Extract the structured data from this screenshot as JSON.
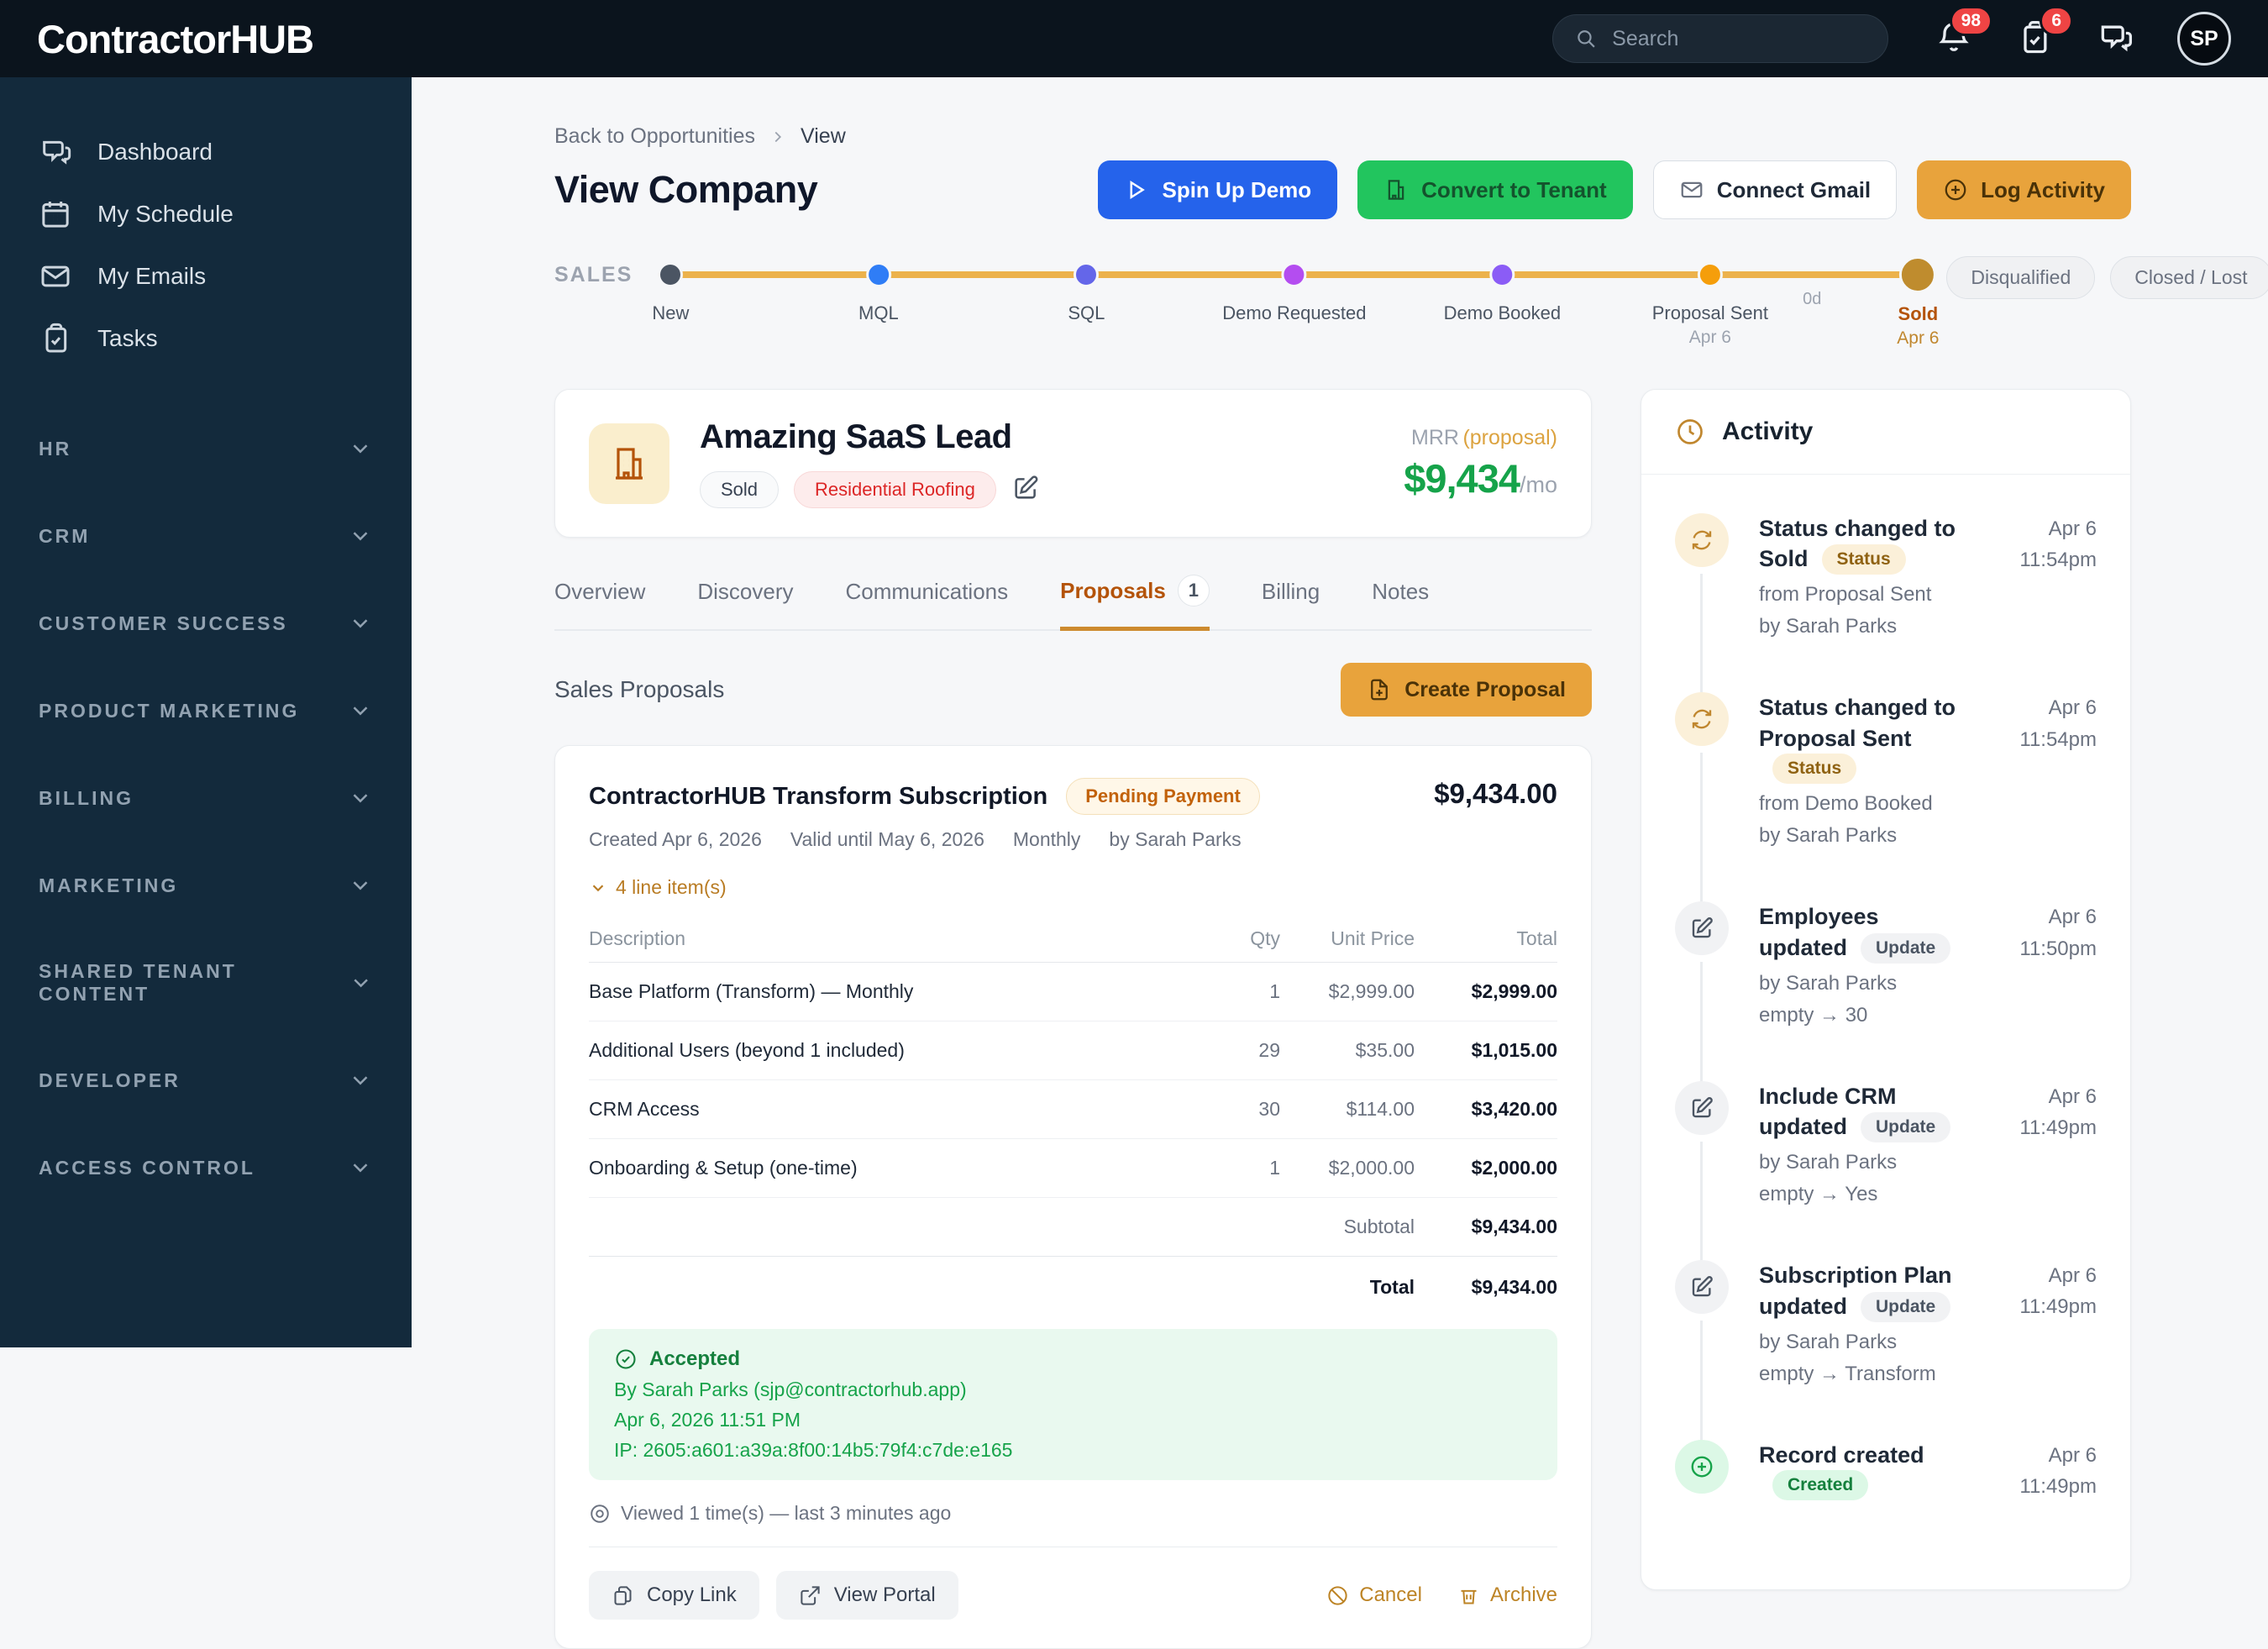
{
  "navbar": {
    "logo_part1": "Contractor",
    "logo_part2": "HUB",
    "search_placeholder": "Search",
    "notifications_badge": "98",
    "tasks_badge": "6",
    "avatar_initials": "SP"
  },
  "sidebar": {
    "items": [
      {
        "label": "Dashboard",
        "icon": "chat-icon"
      },
      {
        "label": "My Schedule",
        "icon": "calendar-icon"
      },
      {
        "label": "My Emails",
        "icon": "mail-icon"
      },
      {
        "label": "Tasks",
        "icon": "clipboard-check-icon"
      }
    ],
    "sections": [
      "HR",
      "CRM",
      "CUSTOMER SUCCESS",
      "PRODUCT MARKETING",
      "BILLING",
      "MARKETING",
      "SHARED TENANT CONTENT",
      "DEVELOPER",
      "ACCESS CONTROL"
    ]
  },
  "header": {
    "breadcrumb_back": "Back to Opportunities",
    "breadcrumb_current": "View",
    "title": "View Company",
    "buttons": {
      "spin_up_demo": "Spin Up Demo",
      "convert_to_tenant": "Convert to Tenant",
      "connect_gmail": "Connect Gmail",
      "log_activity": "Log Activity"
    }
  },
  "pipeline": {
    "label": "SALES",
    "stages": [
      {
        "name": "New",
        "color": "#4b5563"
      },
      {
        "name": "MQL",
        "color": "#2f7df6"
      },
      {
        "name": "SQL",
        "color": "#6466e9"
      },
      {
        "name": "Demo Requested",
        "color": "#b44df0"
      },
      {
        "name": "Demo Booked",
        "color": "#8b5cf6"
      },
      {
        "name": "Proposal Sent",
        "color": "#f59e0b",
        "date": "Apr 6"
      },
      {
        "name": "Sold",
        "color": "#bf8c2e",
        "date": "Apr 6"
      }
    ],
    "duration_label": "0d",
    "terminal_badges": [
      "Disqualified",
      "Closed / Lost"
    ]
  },
  "company": {
    "name": "Amazing SaaS Lead",
    "status_badge": "Sold",
    "industry_badge": "Residential Roofing",
    "mrr_label": "MRR",
    "mrr_qualifier": "(proposal)",
    "mrr_value": "$9,434",
    "mrr_period": "/mo"
  },
  "tabs": {
    "overview": "Overview",
    "discovery": "Discovery",
    "communications": "Communications",
    "proposals": "Proposals",
    "proposals_count": "1",
    "billing": "Billing",
    "notes": "Notes"
  },
  "proposals": {
    "section_title": "Sales Proposals",
    "create_button": "Create Proposal",
    "card": {
      "title": "ContractorHUB Transform Subscription",
      "status_badge": "Pending Payment",
      "amount": "$9,434.00",
      "meta_created": "Created Apr 6, 2026",
      "meta_valid": "Valid until May 6, 2026",
      "meta_billing": "Monthly",
      "meta_author": "by Sarah Parks",
      "line_items_toggle": "4 line item(s)",
      "table": {
        "headers": [
          "Description",
          "Qty",
          "Unit Price",
          "Total"
        ],
        "rows": [
          [
            "Base Platform (Transform) — Monthly",
            "1",
            "$2,999.00",
            "$2,999.00"
          ],
          [
            "Additional Users (beyond 1 included)",
            "29",
            "$35.00",
            "$1,015.00"
          ],
          [
            "CRM Access",
            "30",
            "$114.00",
            "$3,420.00"
          ],
          [
            "Onboarding & Setup (one-time)",
            "1",
            "$2,000.00",
            "$2,000.00"
          ]
        ],
        "subtotal_label": "Subtotal",
        "subtotal_value": "$9,434.00",
        "total_label": "Total",
        "total_value": "$9,434.00"
      },
      "acceptance": {
        "title": "Accepted",
        "by": "By Sarah Parks (sjp@contractorhub.app)",
        "date": "Apr 6, 2026 11:51 PM",
        "ip": "IP: 2605:a601:a39a:8f00:14b5:79f4:c7de:e165"
      },
      "viewed": "Viewed 1 time(s) — last 3 minutes ago",
      "actions": {
        "copy_link": "Copy Link",
        "view_portal": "View Portal",
        "cancel": "Cancel",
        "archive": "Archive"
      }
    }
  },
  "activity": {
    "title": "Activity",
    "items": [
      {
        "title": "Status changed to Sold",
        "badge": "Status",
        "line1": "from Proposal Sent",
        "line2": "by Sarah Parks",
        "date": "Apr 6",
        "time": "11:54pm"
      },
      {
        "title": "Status changed to Proposal Sent",
        "badge": "Status",
        "line1": "from Demo Booked",
        "line2": "by Sarah Parks",
        "date": "Apr 6",
        "time": "11:54pm"
      },
      {
        "title": "Employees updated",
        "badge": "Update",
        "line1": "by Sarah Parks",
        "line2": "empty → 30",
        "date": "Apr 6",
        "time": "11:50pm"
      },
      {
        "title": "Include CRM updated",
        "badge": "Update",
        "line1": "by Sarah Parks",
        "line2": "empty → Yes",
        "date": "Apr 6",
        "time": "11:49pm"
      },
      {
        "title": "Subscription Plan updated",
        "badge": "Update",
        "line1": "by Sarah Parks",
        "line2": "empty → Transform",
        "date": "Apr 6",
        "time": "11:49pm"
      },
      {
        "title": "Record created",
        "badge": "Created",
        "date": "Apr 6",
        "time": "11:49pm"
      }
    ]
  }
}
